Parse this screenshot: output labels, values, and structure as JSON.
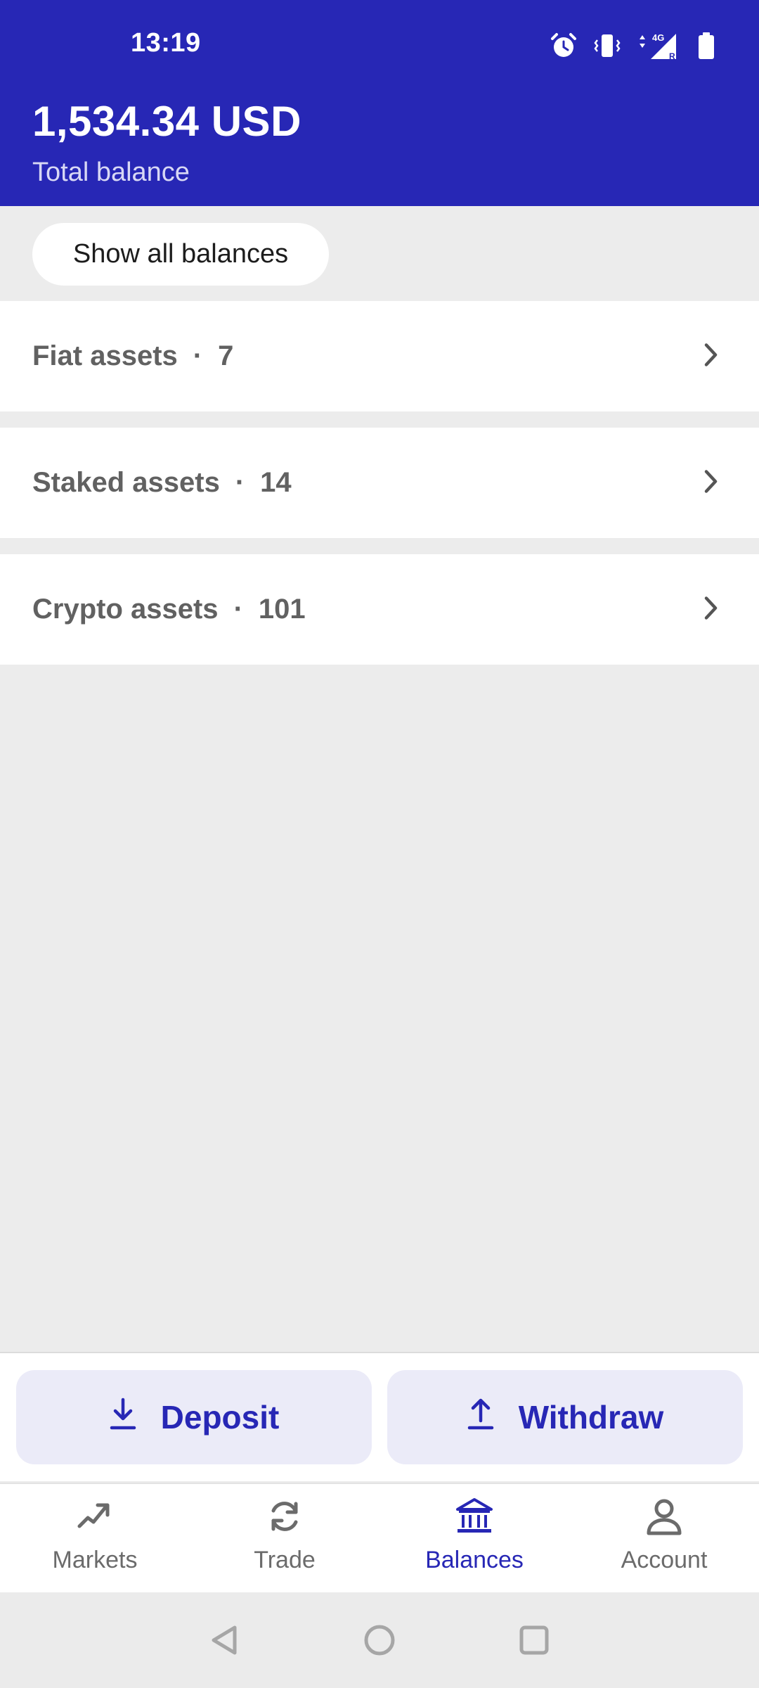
{
  "status_bar": {
    "time": "13:19",
    "network": "4G",
    "icons": [
      "alarm-icon",
      "vibrate-icon",
      "data-arrows-icon",
      "signal-icon",
      "battery-icon"
    ]
  },
  "balance": {
    "amount": "1,534.34 USD",
    "label": "Total balance"
  },
  "show_all_label": "Show all balances",
  "assets": [
    {
      "label": "Fiat assets",
      "separator": "·",
      "count": "7"
    },
    {
      "label": "Staked assets",
      "separator": "·",
      "count": "14"
    },
    {
      "label": "Crypto assets",
      "separator": "·",
      "count": "101"
    }
  ],
  "actions": {
    "deposit_label": "Deposit",
    "withdraw_label": "Withdraw"
  },
  "bottom_nav": [
    {
      "label": "Markets",
      "icon": "trending-up-icon",
      "active": false
    },
    {
      "label": "Trade",
      "icon": "refresh-icon",
      "active": false
    },
    {
      "label": "Balances",
      "icon": "bank-icon",
      "active": true
    },
    {
      "label": "Account",
      "icon": "person-icon",
      "active": false
    }
  ],
  "colors": {
    "brand": "#2727b5",
    "background": "#ececec",
    "action_button_bg": "#ebebf8"
  }
}
